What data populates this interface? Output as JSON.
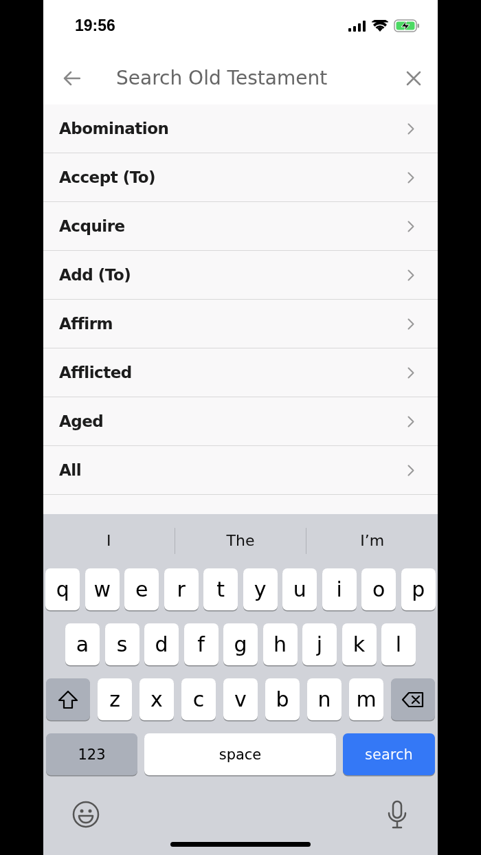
{
  "status_bar": {
    "time": "19:56"
  },
  "header": {
    "placeholder": "Search Old Testament"
  },
  "items": [
    "Abomination",
    "Accept (To)",
    "Acquire",
    "Add (To)",
    "Affirm",
    "Afflicted",
    "Aged",
    "All"
  ],
  "keyboard": {
    "suggestions": [
      "I",
      "The",
      "I’m"
    ],
    "rows": [
      [
        {
          "kind": "letter",
          "label": "q"
        },
        {
          "kind": "letter",
          "label": "w"
        },
        {
          "kind": "letter",
          "label": "e"
        },
        {
          "kind": "letter",
          "label": "r"
        },
        {
          "kind": "letter",
          "label": "t"
        },
        {
          "kind": "letter",
          "label": "y"
        },
        {
          "kind": "letter",
          "label": "u"
        },
        {
          "kind": "letter",
          "label": "i"
        },
        {
          "kind": "letter",
          "label": "o"
        },
        {
          "kind": "letter",
          "label": "p"
        }
      ],
      [
        {
          "kind": "letter",
          "label": "a"
        },
        {
          "kind": "letter",
          "label": "s"
        },
        {
          "kind": "letter",
          "label": "d"
        },
        {
          "kind": "letter",
          "label": "f"
        },
        {
          "kind": "letter",
          "label": "g"
        },
        {
          "kind": "letter",
          "label": "h"
        },
        {
          "kind": "letter",
          "label": "j"
        },
        {
          "kind": "letter",
          "label": "k"
        },
        {
          "kind": "letter",
          "label": "l"
        }
      ],
      [
        {
          "kind": "shift"
        },
        {
          "kind": "letter",
          "label": "z"
        },
        {
          "kind": "letter",
          "label": "x"
        },
        {
          "kind": "letter",
          "label": "c"
        },
        {
          "kind": "letter",
          "label": "v"
        },
        {
          "kind": "letter",
          "label": "b"
        },
        {
          "kind": "letter",
          "label": "n"
        },
        {
          "kind": "letter",
          "label": "m"
        },
        {
          "kind": "backspace"
        }
      ]
    ],
    "bottom_keys": {
      "numbers": "123",
      "space": "space",
      "action": "search"
    }
  }
}
